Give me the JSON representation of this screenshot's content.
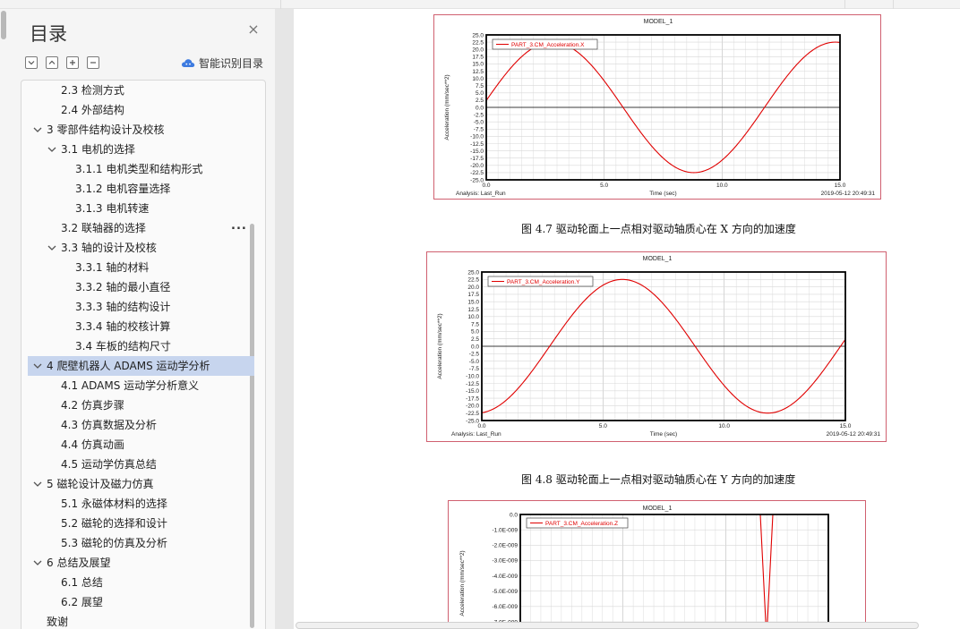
{
  "sidebar": {
    "title": "目录",
    "close_icon": "×",
    "smart_toc_label": "智能识别目录",
    "controls": [
      "collapse-all",
      "expand-all",
      "add-heading",
      "remove-heading"
    ],
    "more_icon": "...",
    "items": [
      {
        "label": "2.3 检测方式",
        "level": 2
      },
      {
        "label": "2.4 外部结构",
        "level": 2
      },
      {
        "label": "3 零部件结构设计及校核",
        "level": 1,
        "expanded": true
      },
      {
        "label": "3.1 电机的选择",
        "level": 2,
        "expanded": true
      },
      {
        "label": "3.1.1 电机类型和结构形式",
        "level": 3
      },
      {
        "label": "3.1.2 电机容量选择",
        "level": 3
      },
      {
        "label": "3.1.3 电机转速",
        "level": 3
      },
      {
        "label": "3.2 联轴器的选择",
        "level": 2
      },
      {
        "label": "3.3 轴的设计及校核",
        "level": 2,
        "expanded": true
      },
      {
        "label": "3.3.1 轴的材料",
        "level": 3
      },
      {
        "label": "3.3.2 轴的最小直径",
        "level": 3
      },
      {
        "label": "3.3.3 轴的结构设计",
        "level": 3
      },
      {
        "label": "3.3.4 轴的校核计算",
        "level": 3
      },
      {
        "label": "3.4 车板的结构尺寸",
        "level": 3
      },
      {
        "label": "4  爬壁机器人 ADAMS 运动学分析",
        "level": 1,
        "expanded": true,
        "selected": true
      },
      {
        "label": "4.1 ADAMS 运动学分析意义",
        "level": 2
      },
      {
        "label": "4.2 仿真步骤",
        "level": 2
      },
      {
        "label": "4.3 仿真数据及分析",
        "level": 2
      },
      {
        "label": "4.4 仿真动画",
        "level": 2
      },
      {
        "label": "4.5 运动学仿真总结",
        "level": 2
      },
      {
        "label": "5  磁轮设计及磁力仿真",
        "level": 1,
        "expanded": true
      },
      {
        "label": "5.1 永磁体材料的选择",
        "level": 2
      },
      {
        "label": "5.2 磁轮的选择和设计",
        "level": 2
      },
      {
        "label": "5.3 磁轮的仿真及分析",
        "level": 2
      },
      {
        "label": "6  总结及展望",
        "level": 1,
        "expanded": true
      },
      {
        "label": "6.1 总结",
        "level": 2
      },
      {
        "label": "6.2 展望",
        "level": 2
      },
      {
        "label": "致谢",
        "level": 0
      }
    ]
  },
  "document": {
    "captions": [
      "图 4.7  驱动轮面上一点相对驱动轴质心在 X 方向的加速度",
      "图 4.8  驱动轮面上一点相对驱动轴质心在 Y 方向的加速度"
    ]
  },
  "chart_data": [
    {
      "type": "line",
      "title": "MODEL_1",
      "legend": "PART_3.CM_Acceleration.X",
      "xlabel": "Time (sec)",
      "ylabel": "Acceleration (mm/sec**2)",
      "xlim": [
        0,
        15
      ],
      "ylim": [
        -25,
        25
      ],
      "xticks": [
        "0.0",
        "5.0",
        "10.0",
        "15.0"
      ],
      "yticks": [
        "25.0",
        "22.5",
        "20.0",
        "17.5",
        "15.0",
        "12.5",
        "10.0",
        "7.5",
        "5.0",
        "2.5",
        "0.0",
        "-2.5",
        "-5.0",
        "-7.5",
        "-10.0",
        "-12.5",
        "-15.0",
        "-17.5",
        "-20.0",
        "-22.5",
        "-25.0"
      ],
      "footer_left": "Analysis:  Last_Run",
      "footer_right": "2019-05-12 20:49:31",
      "series": [
        {
          "name": "PART_3.CM_Acceleration.X",
          "amplitude": 22.5,
          "period": 12.0,
          "phase_deg": 6,
          "color": "#e00000"
        }
      ]
    },
    {
      "type": "line",
      "title": "MODEL_1",
      "legend": "PART_3.CM_Acceleration.Y",
      "xlabel": "Time (sec)",
      "ylabel": "Acceleration (mm/sec**2)",
      "xlim": [
        0,
        15
      ],
      "ylim": [
        -25,
        25
      ],
      "xticks": [
        "0.0",
        "5.0",
        "10.0",
        "15.0"
      ],
      "yticks": [
        "25.0",
        "22.5",
        "20.0",
        "17.5",
        "15.0",
        "12.5",
        "10.0",
        "7.5",
        "5.0",
        "2.5",
        "0.0",
        "-2.5",
        "-5.0",
        "-7.5",
        "-10.0",
        "-12.5",
        "-15.0",
        "-17.5",
        "-20.0",
        "-22.5",
        "-25.0"
      ],
      "footer_left": "Analysis:  Last_Run",
      "footer_right": "2019-05-12 20:49:31",
      "series": [
        {
          "name": "PART_3.CM_Acceleration.Y",
          "amplitude": 22.5,
          "period": 12.0,
          "phase_deg": -84,
          "color": "#e00000"
        }
      ]
    },
    {
      "type": "line",
      "title": "MODEL_1",
      "legend": "PART_3.CM_Acceleration.Z",
      "xlabel": "",
      "ylabel": "Acceleration (mm/sec**2)",
      "ylim": [
        -7e-09,
        0.0
      ],
      "yticks": [
        "0.0",
        "-1.0E-009",
        "-2.0E-009",
        "-3.0E-009",
        "-4.0E-009",
        "-5.0E-009",
        "-6.0E-009",
        "-7.0E-009"
      ],
      "series": [
        {
          "name": "PART_3.CM_Acceleration.Z",
          "color": "#e00000"
        }
      ]
    }
  ],
  "colors": {
    "curve": "#e00000",
    "frame": "#d06070",
    "selected_bg": "#c7d5ee"
  }
}
